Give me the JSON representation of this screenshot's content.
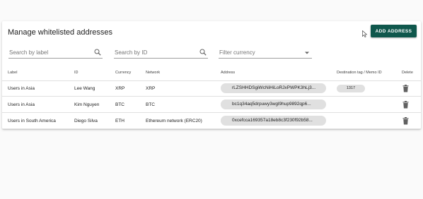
{
  "header": {
    "title": "Manage whitelisted addresses",
    "add_button_label": "ADD ADDRESS"
  },
  "filters": {
    "label_placeholder": "Search by label",
    "id_placeholder": "Search by ID",
    "currency_placeholder": "Filter currency"
  },
  "table": {
    "columns": [
      "Label",
      "ID",
      "Currency",
      "Network",
      "Address",
      "Destination tag / Memo ID",
      "Delete"
    ],
    "rows": [
      {
        "label": "Users in Asia",
        "id": "Lee Wang",
        "currency": "XRP",
        "network": "XRP",
        "address": "rLZSHHDSgiWcNiHiLoRJxPWPK3hLj3...",
        "tag": "1317"
      },
      {
        "label": "Users in Asia",
        "id": "Kim Nguyen",
        "currency": "BTC",
        "network": "BTC",
        "address": "bc1q34aq5drpuwy3wgl9hup9892qp6...",
        "tag": ""
      },
      {
        "label": "Users in South America",
        "id": "Diego Silva",
        "currency": "ETH",
        "network": "Ethereum network (ERC20)",
        "address": "0xcefcca169357a18eb8c3f230f92b58...",
        "tag": ""
      }
    ]
  },
  "icons": {
    "search": "search-icon",
    "dropdown": "arrow-drop-down-icon",
    "delete": "trash-icon",
    "cursor": "mouse-cursor-icon"
  },
  "colors": {
    "accent": "#0f574c",
    "pill": "#e0e0e0"
  }
}
